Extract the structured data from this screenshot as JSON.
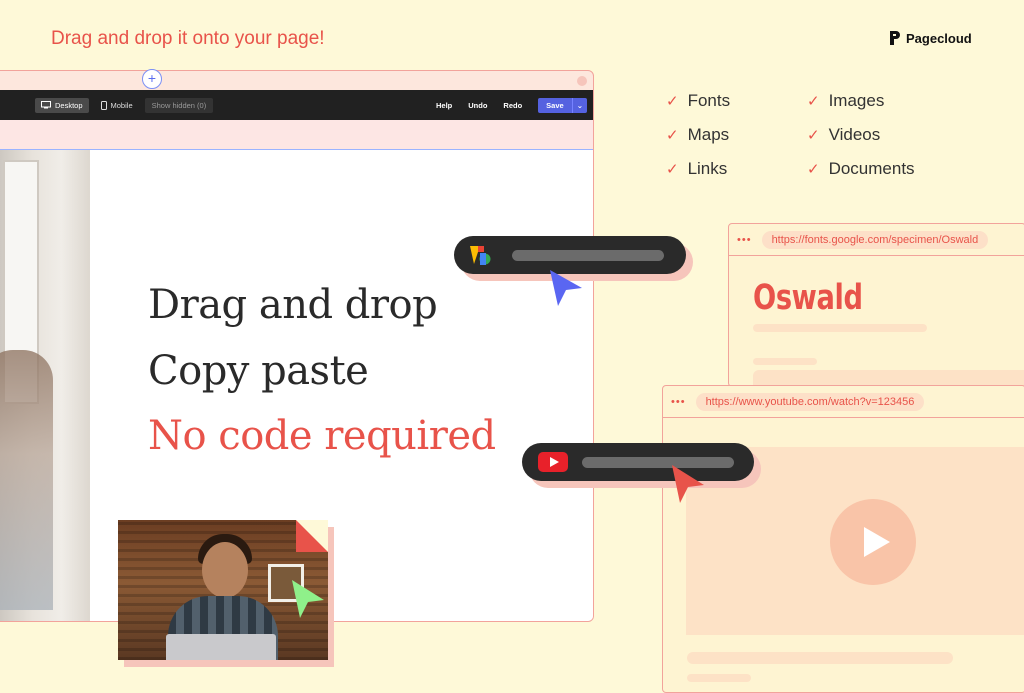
{
  "headline": "Drag and drop it onto your page!",
  "brand": {
    "name": "Pagecloud"
  },
  "editor": {
    "toolbar": {
      "desktop": "Desktop",
      "mobile": "Mobile",
      "show_hidden": "Show hidden (0)",
      "help": "Help",
      "undo": "Undo",
      "redo": "Redo",
      "save": "Save"
    },
    "hero_lines": [
      "Drag and drop",
      "Copy paste",
      "No code required"
    ]
  },
  "features": [
    "Fonts",
    "Images",
    "Maps",
    "Videos",
    "Links",
    "Documents"
  ],
  "cards": {
    "fonts": {
      "url": "https://fonts.google.com/specimen/Oswald",
      "title": "Oswald"
    },
    "youtube": {
      "url": "https://www.youtube.com/watch?v=123456"
    }
  },
  "colors": {
    "background": "#fef9d8",
    "accent": "#e8534a",
    "toolbar": "#212121",
    "save_button": "#5562e0"
  },
  "icons": [
    "pagecloud-logo-icon",
    "desktop-icon",
    "mobile-icon",
    "plus-icon",
    "check-icon",
    "google-fonts-icon",
    "youtube-icon",
    "cursor-icon",
    "play-icon"
  ]
}
